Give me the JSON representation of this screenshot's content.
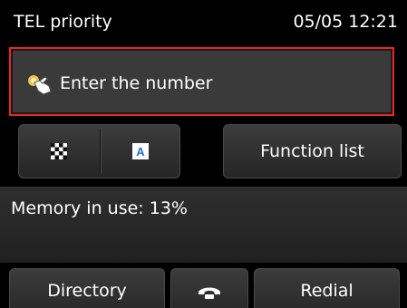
{
  "status_bar": {
    "title": "TEL priority",
    "datetime": "05/05 12:21"
  },
  "number_field": {
    "label": "Enter the number",
    "icon": "tap-finger-icon",
    "border_color": "#e8252a"
  },
  "mode_buttons": [
    {
      "icon": "checker-pattern-icon"
    },
    {
      "icon": "letter-a-icon",
      "letter": "A"
    }
  ],
  "function_list_label": "Function list",
  "memory_status": "Memory in use: 13%",
  "bottom_bar": {
    "directory_label": "Directory",
    "hook_icon": "on-hook-phone-icon",
    "redial_label": "Redial"
  }
}
